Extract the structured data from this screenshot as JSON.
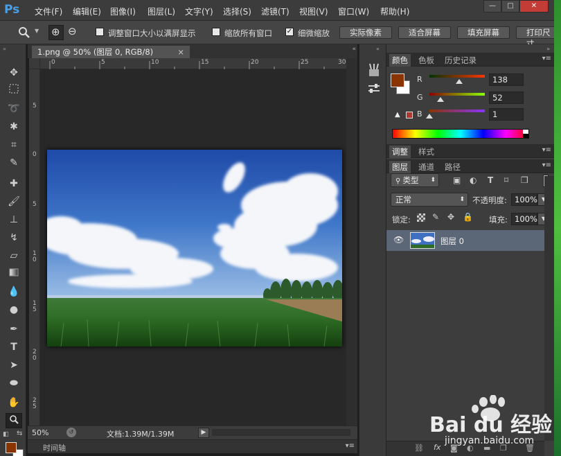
{
  "menu": {
    "logo": "Ps",
    "items": [
      "文件(F)",
      "编辑(E)",
      "图像(I)",
      "图层(L)",
      "文字(Y)",
      "选择(S)",
      "滤镜(T)",
      "视图(V)",
      "窗口(W)",
      "帮助(H)"
    ],
    "window_controls": {
      "minimize": "—",
      "restore": "□",
      "close": "✕"
    }
  },
  "options": {
    "tool_icon": "zoom-icon",
    "zoom_in_icon": "⊕",
    "zoom_out_icon": "⊖",
    "resize_windows_label": "调整窗口大小以满屏显示",
    "resize_windows_checked": false,
    "zoom_all_label": "缩放所有窗口",
    "zoom_all_checked": false,
    "scrubby_label": "细微缩放",
    "scrubby_checked": true,
    "actual_pixels": "实际像素",
    "fit_screen": "适合屏幕",
    "fill_screen": "填充屏幕",
    "print_size": "打印尺寸"
  },
  "document": {
    "tab_title": "1.png @ 50% (图层 0, RGB/8)",
    "tab_close": "×",
    "ruler_top_ticks": [
      "0",
      "5",
      "10",
      "15",
      "20",
      "25",
      "30"
    ],
    "ruler_left_ticks": [
      "5",
      "0",
      "5",
      "1\n0",
      "1\n5",
      "2\n0",
      "2\n5"
    ]
  },
  "status": {
    "zoom": "50%",
    "doc_info": "文档:1.39M/1.39M",
    "arrow": "▶"
  },
  "timeline": {
    "label": "时间轴"
  },
  "color_panel": {
    "tabs": [
      "颜色",
      "色板",
      "历史记录"
    ],
    "active_tab": "颜色",
    "r_label": "R",
    "g_label": "G",
    "b_label": "B",
    "r": "138",
    "g": "52",
    "b": "1",
    "r_fraction": 0.54,
    "g_fraction": 0.2,
    "b_fraction": 0.0,
    "foreground": "#8a3401",
    "background": "#ffffff"
  },
  "adjust_panel": {
    "tabs": [
      "调整",
      "样式"
    ],
    "active_tab": "调整"
  },
  "layers_panel": {
    "tabs": [
      "图层",
      "通道",
      "路径"
    ],
    "active_tab": "图层",
    "filter_label": "类型",
    "blend_mode": "正常",
    "opacity_label": "不透明度:",
    "opacity": "100%",
    "lock_label": "锁定:",
    "fill_label": "填充:",
    "fill": "100%",
    "layers": [
      {
        "name": "图层 0",
        "visible": true
      }
    ]
  },
  "watermark": {
    "brand": "Bai du 经验",
    "url": "jingyan.baidu.com"
  }
}
